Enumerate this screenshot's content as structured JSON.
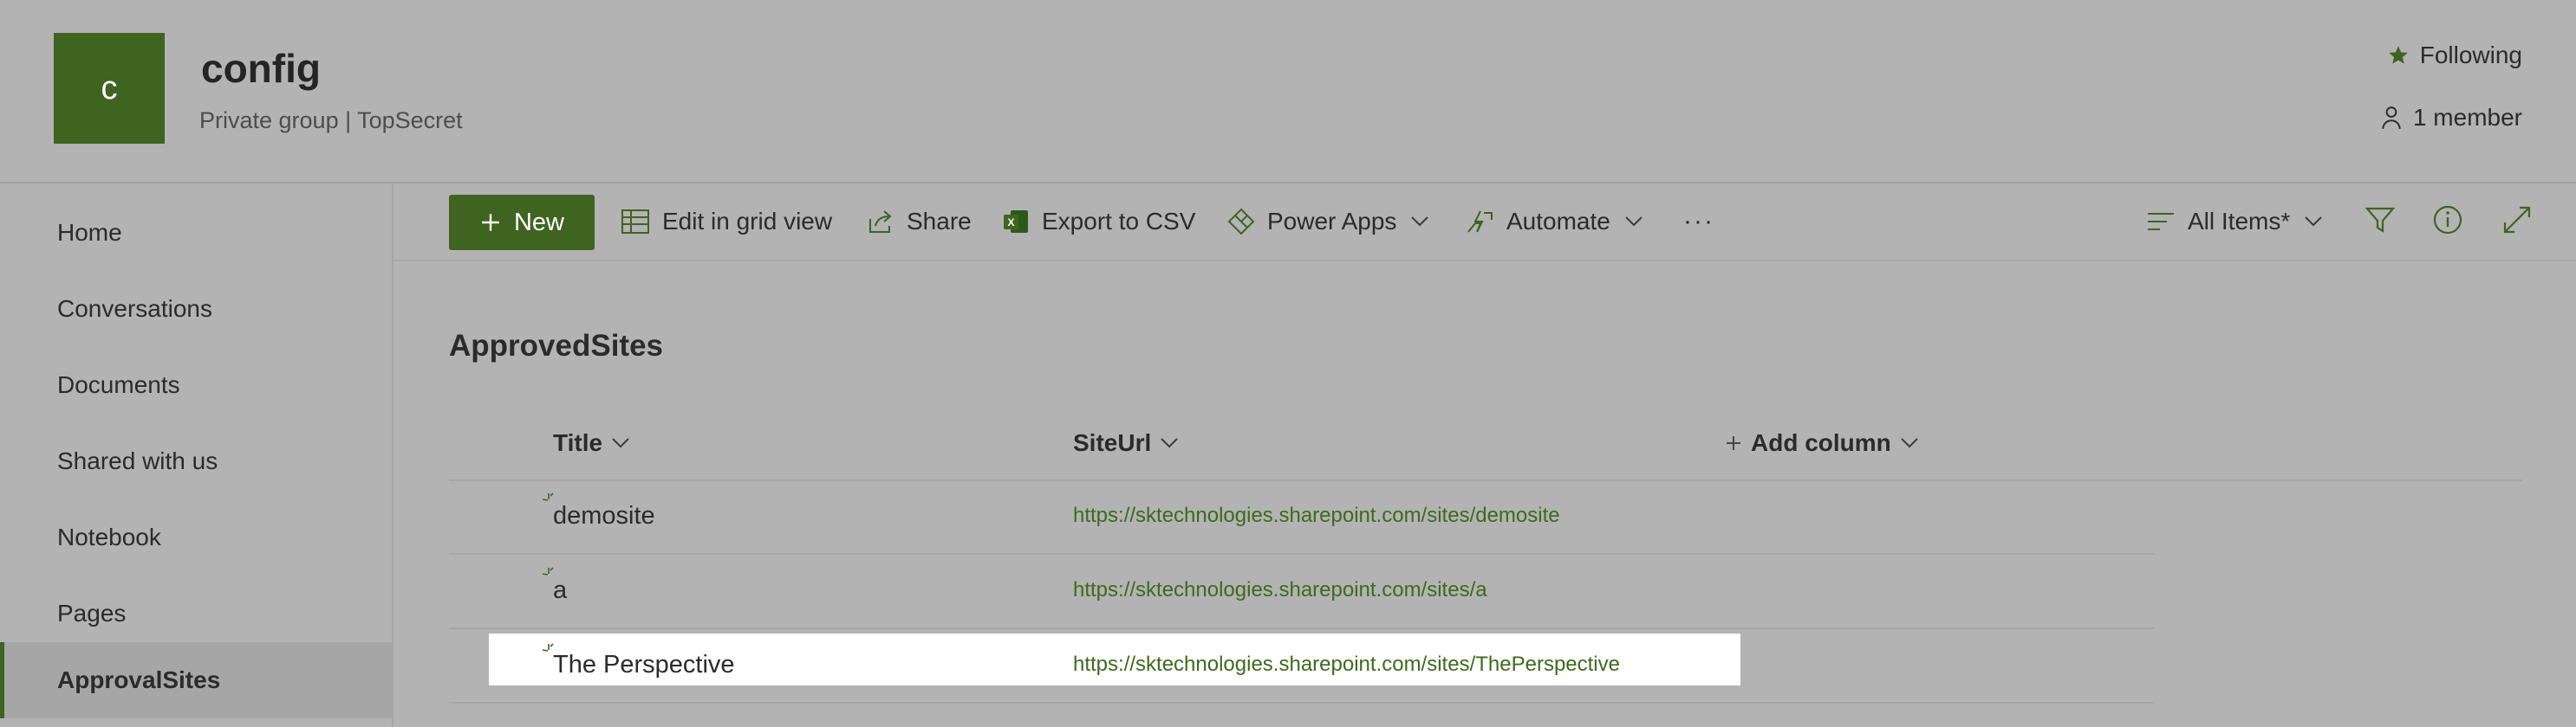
{
  "header": {
    "logo_letter": "c",
    "site_title": "config",
    "site_subtitle": "Private group | TopSecret",
    "following_label": "Following",
    "members_label": "1 member"
  },
  "sidebar": {
    "items": [
      {
        "label": "Home"
      },
      {
        "label": "Conversations"
      },
      {
        "label": "Documents"
      },
      {
        "label": "Shared with us"
      },
      {
        "label": "Notebook"
      },
      {
        "label": "Pages"
      },
      {
        "label": "ApprovalSites",
        "active": true
      }
    ]
  },
  "toolbar": {
    "new_label": "New",
    "grid_label": "Edit in grid view",
    "share_label": "Share",
    "export_label": "Export to CSV",
    "powerapps_label": "Power Apps",
    "automate_label": "Automate",
    "more_label": "···",
    "view_label": "All Items*"
  },
  "list": {
    "title": "ApprovedSites",
    "columns": {
      "title": "Title",
      "siteurl": "SiteUrl",
      "add": "Add column"
    },
    "rows": [
      {
        "title": "demosite",
        "url": "https://sktechnologies.sharepoint.com/sites/demosite"
      },
      {
        "title": "a",
        "url": "https://sktechnologies.sharepoint.com/sites/a"
      },
      {
        "title": "The Perspective",
        "url": "https://sktechnologies.sharepoint.com/sites/ThePerspective",
        "selected": true
      }
    ]
  },
  "colors": {
    "accent": "#3f6420",
    "link": "#3d6a1c",
    "overlay_gray": "#b3b3b3"
  },
  "icons": [
    "star-icon",
    "person-icon",
    "plus-icon",
    "grid-icon",
    "share-icon",
    "excel-icon",
    "powerapps-icon",
    "automate-icon",
    "chevron-down-icon",
    "view-lines-icon",
    "filter-icon",
    "info-icon",
    "expand-icon",
    "new-item-sparkle-icon"
  ]
}
